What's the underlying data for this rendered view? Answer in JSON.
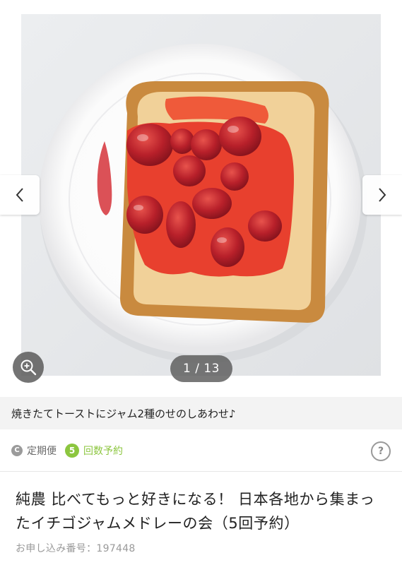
{
  "carousel": {
    "counter": "1 / 13",
    "prev_icon": "chevron-left-icon",
    "next_icon": "chevron-right-icon",
    "zoom_icon": "zoom-in-icon"
  },
  "caption": "焼きたてトーストにジャム2種のせのしあわせ♪",
  "tags": {
    "teiki": {
      "icon_letter": "C",
      "label": "定期便"
    },
    "count": {
      "icon_number": "5",
      "label": "回数予約"
    }
  },
  "help_label": "?",
  "product": {
    "title": "純農 比べてもっと好きになる！ 日本各地から集まったイチゴジャムメドレーの会（5回予約）",
    "order_number": "お申し込み番号：197448"
  },
  "colors": {
    "accent_green": "#8cc63f",
    "muted_gray": "#9a9a9a",
    "caption_bg": "#f3f3f3"
  }
}
